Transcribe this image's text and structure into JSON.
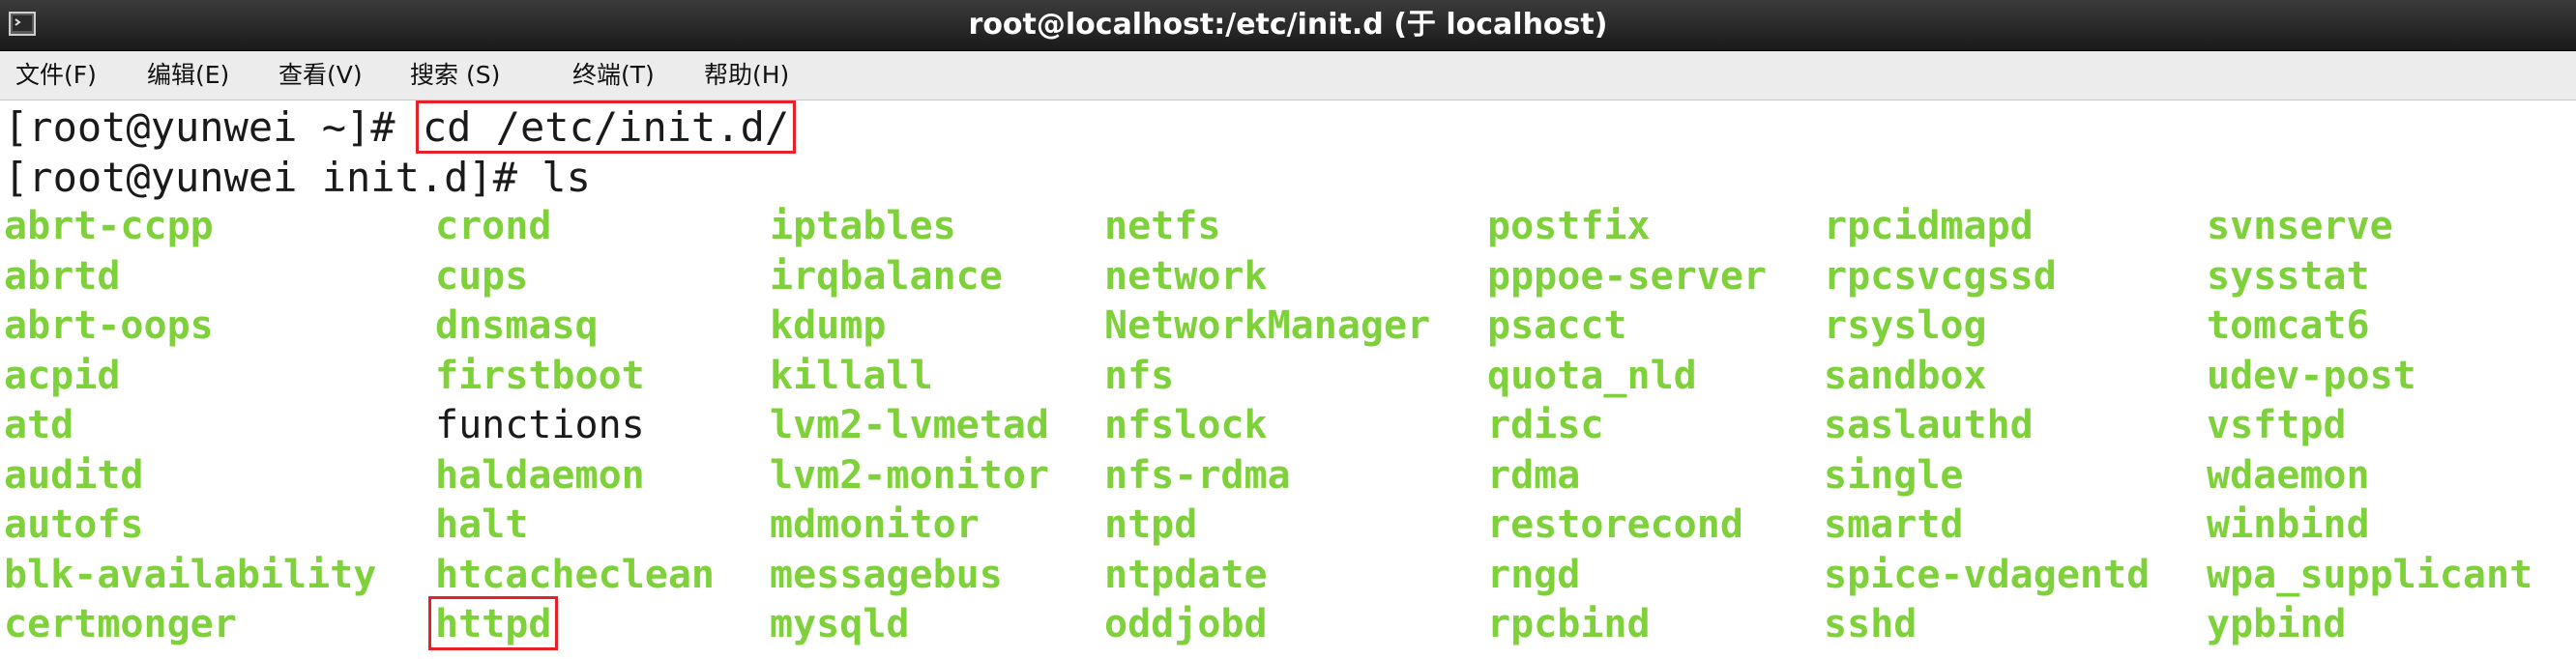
{
  "window": {
    "title": "root@localhost:/etc/init.d (于 localhost)",
    "icon": "terminal-icon"
  },
  "menu": {
    "items": [
      "文件(F)",
      "编辑(E)",
      "查看(V)",
      "搜索 (S)",
      "终端(T)",
      "帮助(H)"
    ]
  },
  "terminal": {
    "line1": {
      "prompt": "[root@yunwei ~]# ",
      "command": "cd /etc/init.d/"
    },
    "line2": {
      "prompt": "[root@yunwei init.d]# ",
      "command": "ls"
    },
    "columns": [
      [
        "abrt-ccpp",
        "abrtd",
        "abrt-oops",
        "acpid",
        "atd",
        "auditd",
        "autofs",
        "blk-availability",
        "certmonger"
      ],
      [
        "crond",
        "cups",
        "dnsmasq",
        "firstboot",
        "functions",
        "haldaemon",
        "halt",
        "htcacheclean",
        "httpd"
      ],
      [
        "iptables",
        "irqbalance",
        "kdump",
        "killall",
        "lvm2-lvmetad",
        "lvm2-monitor",
        "mdmonitor",
        "messagebus",
        "mysqld"
      ],
      [
        "netfs",
        "network",
        "NetworkManager",
        "nfs",
        "nfslock",
        "nfs-rdma",
        "ntpd",
        "ntpdate",
        "oddjobd"
      ],
      [
        "postfix",
        "pppoe-server",
        "psacct",
        "quota_nld",
        "rdisc",
        "rdma",
        "restorecond",
        "rngd",
        "rpcbind"
      ],
      [
        "rpcidmapd",
        "rpcsvcgssd",
        "rsyslog",
        "sandbox",
        "saslauthd",
        "single",
        "smartd",
        "spice-vdagentd",
        "sshd"
      ],
      [
        "svnserve",
        "sysstat",
        "tomcat6",
        "udev-post",
        "vsftpd",
        "wdaemon",
        "winbind",
        "wpa_supplicant",
        "ypbind"
      ]
    ],
    "plain_entries": [
      "functions"
    ],
    "highlighted_entries": [
      "httpd"
    ],
    "colors": {
      "executable": "#7fd13b",
      "plain": "#1a1a1a",
      "highlight_box": "#e8202a"
    }
  }
}
